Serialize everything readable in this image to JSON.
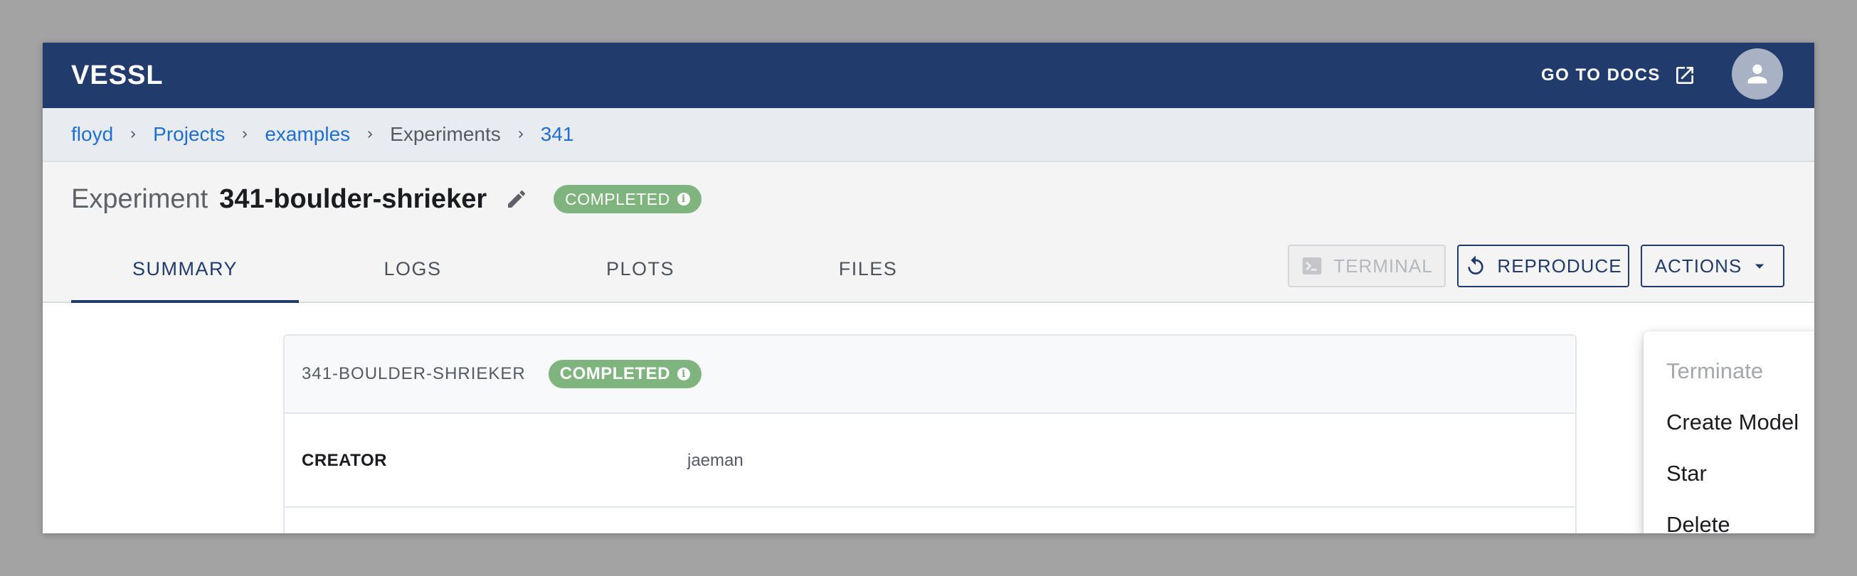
{
  "header": {
    "logo": "VESSL",
    "docs_label": "GO TO DOCS"
  },
  "breadcrumb": {
    "items": [
      "floyd",
      "Projects",
      "examples",
      "Experiments",
      "341"
    ]
  },
  "title": {
    "prefix": "Experiment",
    "name": "341-boulder-shrieker",
    "status": "COMPLETED"
  },
  "tabs": [
    "SUMMARY",
    "LOGS",
    "PLOTS",
    "FILES"
  ],
  "toolbar": {
    "terminal_label": "TERMINAL",
    "reproduce_label": "REPRODUCE",
    "actions_label": "ACTIONS"
  },
  "card": {
    "title": "341-BOULDER-SHRIEKER",
    "status": "COMPLETED",
    "rows": [
      {
        "label": "CREATOR",
        "value": "jaeman"
      }
    ]
  },
  "actions_menu": {
    "items": [
      "Terminate",
      "Create Model",
      "Star",
      "Delete"
    ]
  },
  "colors": {
    "nav_bg": "#223b6d",
    "link": "#1f6fd0",
    "status_completed": "#7fb47f"
  }
}
